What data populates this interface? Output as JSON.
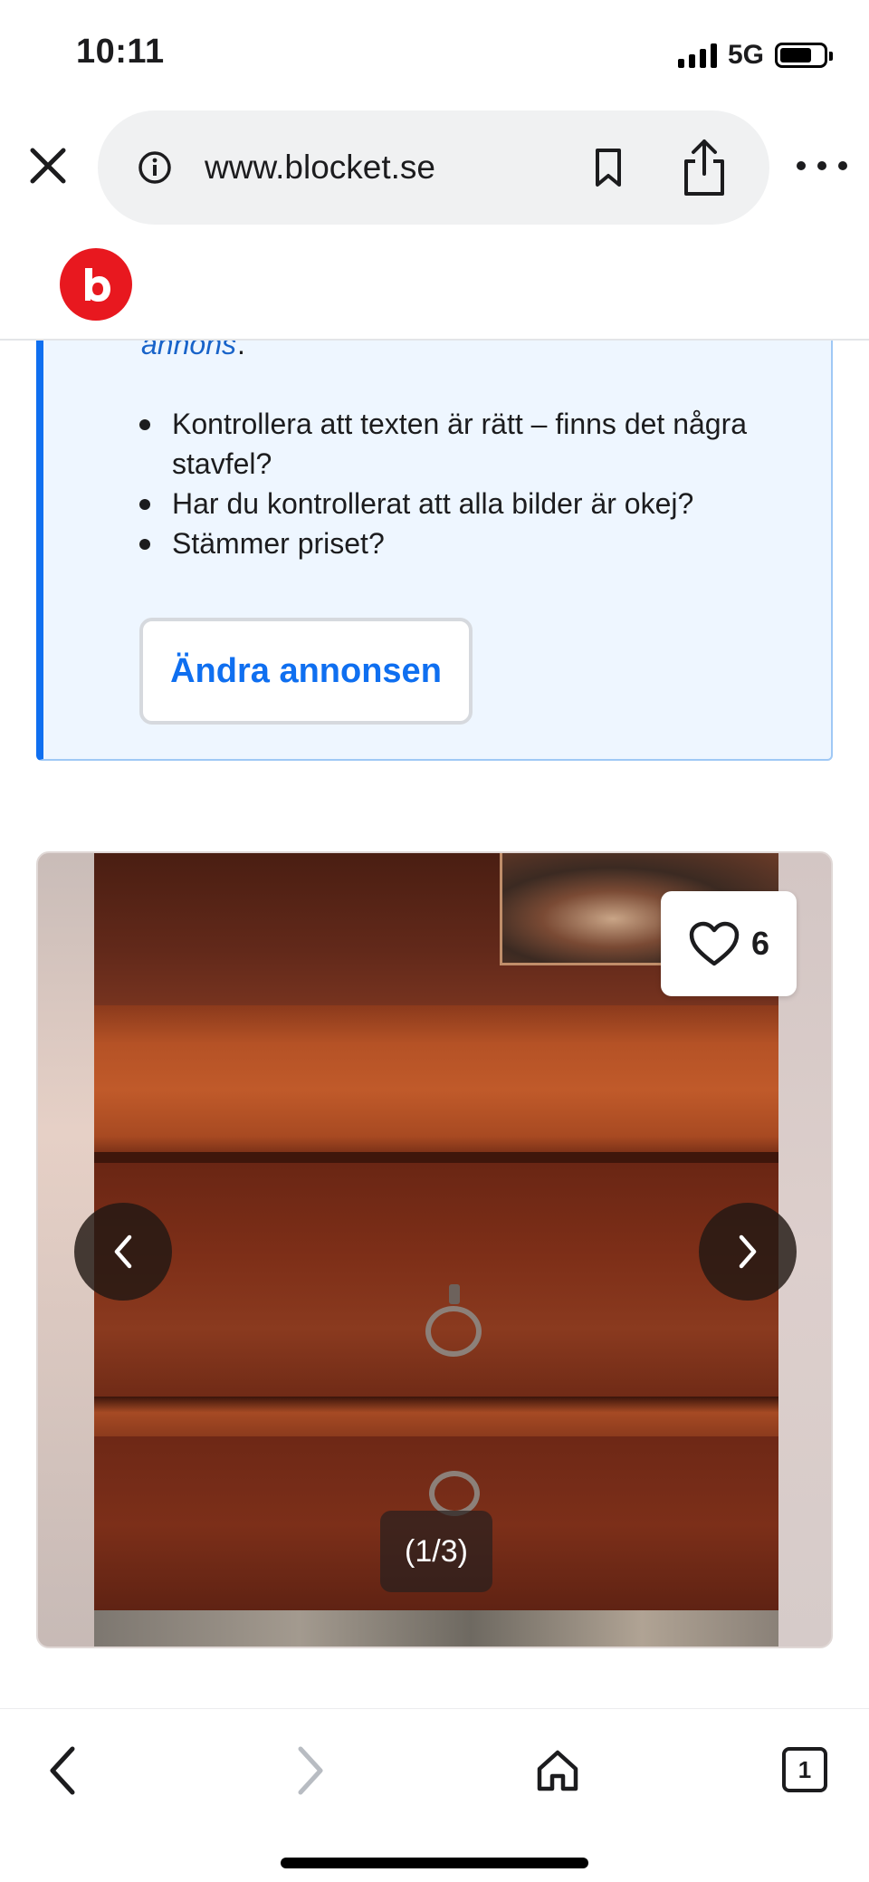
{
  "status_bar": {
    "time": "10:11",
    "network": "5G"
  },
  "browser": {
    "url": "www.blocket.se"
  },
  "info_card": {
    "link_text": "annons",
    "link_suffix": ".",
    "checklist": [
      "Kontrollera att texten är rätt – finns det några stavfel?",
      "Har du kontrollerat att alla bilder är okej?",
      "Stämmer priset?"
    ],
    "edit_button": "Ändra annonsen"
  },
  "gallery": {
    "favorite_count": "6",
    "image_counter": "(1/3)"
  },
  "toolbar": {
    "tab_count": "1"
  },
  "colors": {
    "brand_red": "#e8181f",
    "link_blue": "#1863c9",
    "accent_blue": "#0f6ff0",
    "info_bg": "#eef6ff"
  },
  "icons": [
    "close-icon",
    "info-icon",
    "bookmark-icon",
    "share-icon",
    "more-icon",
    "blocket-logo",
    "heart-icon",
    "chevron-left-icon",
    "chevron-right-icon",
    "back-icon",
    "forward-icon",
    "home-icon",
    "tabs-icon"
  ]
}
